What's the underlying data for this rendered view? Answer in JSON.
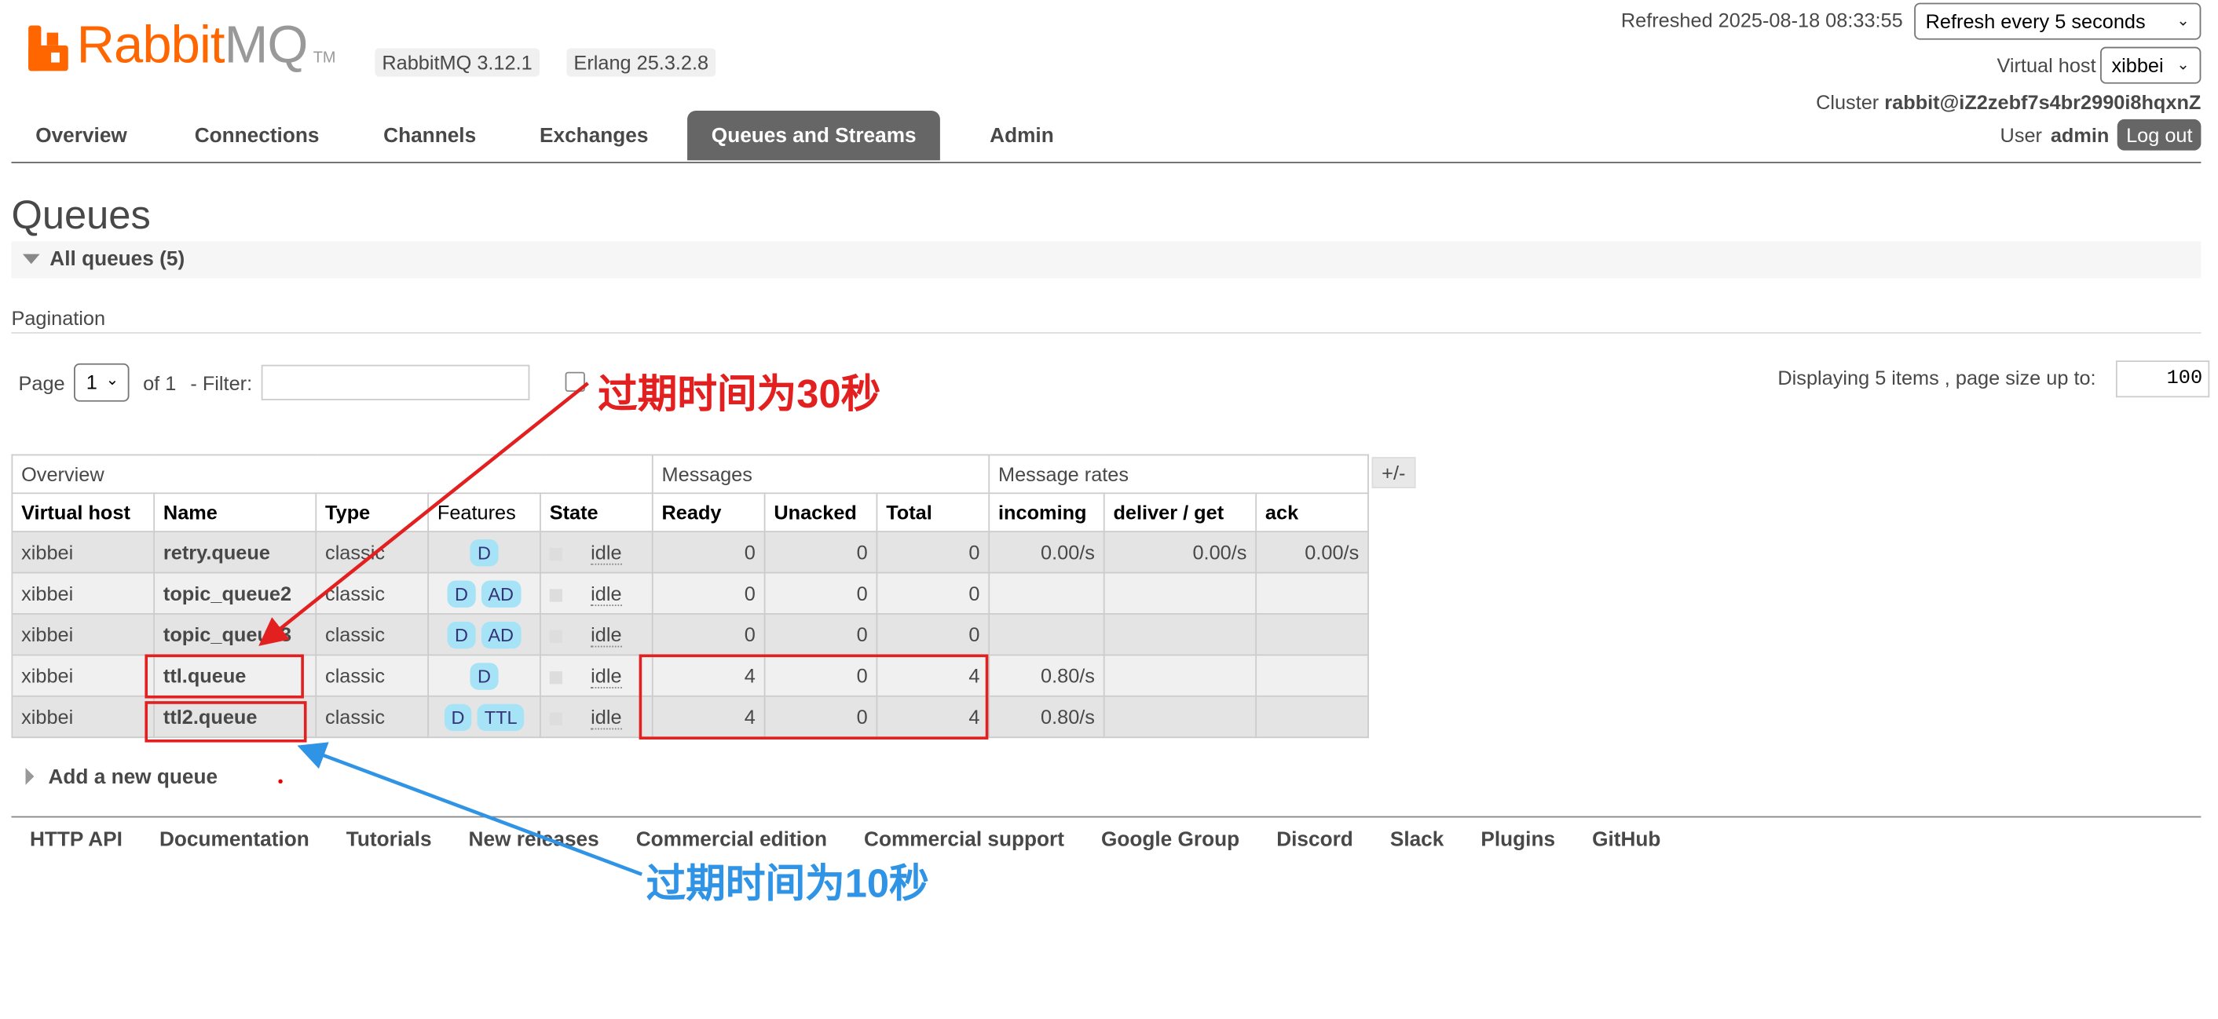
{
  "header": {
    "brand_r": "Rabbit",
    "brand_m": "MQ",
    "tm": "TM",
    "rabbitmq_version": "RabbitMQ 3.12.1",
    "erlang_version": "Erlang 25.3.2.8",
    "refreshed": "Refreshed 2025-08-18 08:33:55",
    "refresh_select": "Refresh every 5 seconds",
    "vhost_label": "Virtual host",
    "vhost_value": "xibbei",
    "cluster_label": "Cluster",
    "cluster_name": "rabbit@iZ2zebf7s4br2990i8hqxnZ",
    "user_label": "User",
    "user_name": "admin",
    "logout": "Log out"
  },
  "tabs": [
    "Overview",
    "Connections",
    "Channels",
    "Exchanges",
    "Queues and Streams",
    "Admin"
  ],
  "page": {
    "title": "Queues",
    "section": "All queues (5)",
    "pagination_label": "Pagination",
    "page_label": "Page",
    "page_value": "1",
    "of_label": "of 1",
    "filter_label": "- Filter:",
    "displaying": "Displaying 5 items , page size up to:",
    "page_size": "100",
    "plus_minus": "+/-",
    "add_queue": "Add a new queue"
  },
  "table": {
    "groups": [
      "Overview",
      "Messages",
      "Message rates"
    ],
    "columns": [
      "Virtual host",
      "Name",
      "Type",
      "Features",
      "State",
      "Ready",
      "Unacked",
      "Total",
      "incoming",
      "deliver / get",
      "ack"
    ],
    "rows": [
      {
        "vhost": "xibbei",
        "name": "retry.queue",
        "type": "classic",
        "features": [
          "D"
        ],
        "state": "idle",
        "ready": "0",
        "unacked": "0",
        "total": "0",
        "incoming": "0.00/s",
        "deliver": "0.00/s",
        "ack": "0.00/s"
      },
      {
        "vhost": "xibbei",
        "name": "topic_queue2",
        "type": "classic",
        "features": [
          "D",
          "AD"
        ],
        "state": "idle",
        "ready": "0",
        "unacked": "0",
        "total": "0",
        "incoming": "",
        "deliver": "",
        "ack": ""
      },
      {
        "vhost": "xibbei",
        "name": "topic_queue3",
        "type": "classic",
        "features": [
          "D",
          "AD"
        ],
        "state": "idle",
        "ready": "0",
        "unacked": "0",
        "total": "0",
        "incoming": "",
        "deliver": "",
        "ack": ""
      },
      {
        "vhost": "xibbei",
        "name": "ttl.queue",
        "type": "classic",
        "features": [
          "D"
        ],
        "state": "idle",
        "ready": "4",
        "unacked": "0",
        "total": "4",
        "incoming": "0.80/s",
        "deliver": "",
        "ack": ""
      },
      {
        "vhost": "xibbei",
        "name": "ttl2.queue",
        "type": "classic",
        "features": [
          "D",
          "TTL"
        ],
        "state": "idle",
        "ready": "4",
        "unacked": "0",
        "total": "4",
        "incoming": "0.80/s",
        "deliver": "",
        "ack": ""
      }
    ]
  },
  "footer": [
    "HTTP API",
    "Documentation",
    "Tutorials",
    "New releases",
    "Commercial edition",
    "Commercial support",
    "Google Group",
    "Discord",
    "Slack",
    "Plugins",
    "GitHub"
  ],
  "annotations": {
    "red_note": "过期时间为30秒",
    "blue_note": "过期时间为10秒",
    "red_color": "#e32020",
    "blue_color": "#2f93e6"
  }
}
